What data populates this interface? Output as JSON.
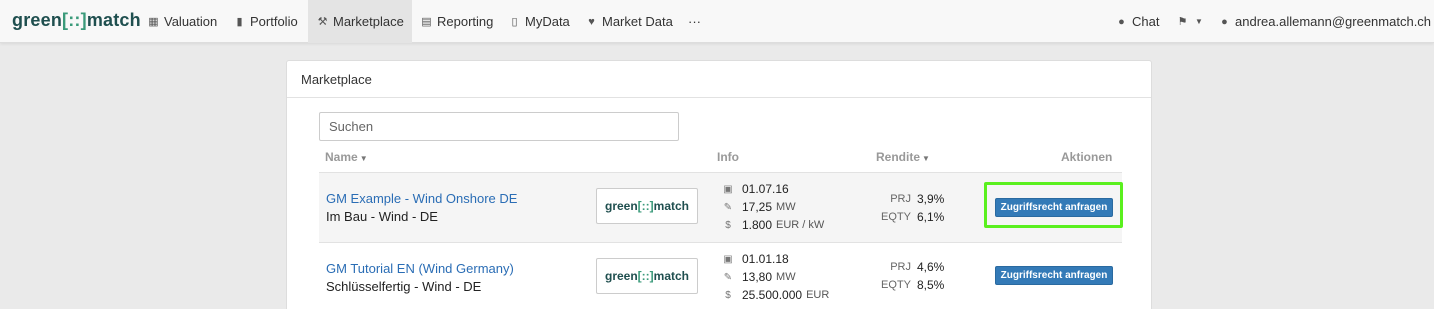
{
  "brand": {
    "prefix": "green",
    "mark": "[::]",
    "suffix": "match"
  },
  "nav": {
    "items": [
      {
        "label": "Valuation",
        "icon": "dashboard-grid-icon"
      },
      {
        "label": "Portfolio",
        "icon": "bar-chart-icon"
      },
      {
        "label": "Marketplace",
        "icon": "gavel-icon",
        "active": true
      },
      {
        "label": "Reporting",
        "icon": "document-icon"
      },
      {
        "label": "MyData",
        "icon": "file-upload-icon"
      },
      {
        "label": "Market Data",
        "icon": "heartbeat-icon"
      }
    ],
    "more": "···",
    "chat": "Chat",
    "user": "andrea.allemann@greenmatch.ch"
  },
  "panel": {
    "title": "Marketplace",
    "search_placeholder": "Suchen",
    "columns": {
      "name": "Name",
      "info": "Info",
      "rendite": "Rendite",
      "aktionen": "Aktionen"
    }
  },
  "rows": [
    {
      "name": "GM Example - Wind Onshore DE",
      "sub": "Im Bau - Wind - DE",
      "date": "01.07.16",
      "power": "17,25",
      "power_unit": "MW",
      "cost": "1.800",
      "cost_unit": "EUR / kW",
      "prj_label": "PRJ",
      "prj": "3,9%",
      "eqty_label": "EQTY",
      "eqty": "6,1%",
      "action": "Zugriffsrecht anfragen"
    },
    {
      "name": "GM Tutorial EN (Wind Germany)",
      "sub": "Schlüsselfertig - Wind - DE",
      "date": "01.01.18",
      "power": "13,80",
      "power_unit": "MW",
      "cost": "25.500.000",
      "cost_unit": "EUR",
      "prj_label": "PRJ",
      "prj": "4,6%",
      "eqty_label": "EQTY",
      "eqty": "8,5%",
      "action": "Zugriffsrecht anfragen"
    }
  ],
  "colors": {
    "accent": "#337ab7",
    "highlight": "#5af01e",
    "brand": "#1f4f4f"
  }
}
